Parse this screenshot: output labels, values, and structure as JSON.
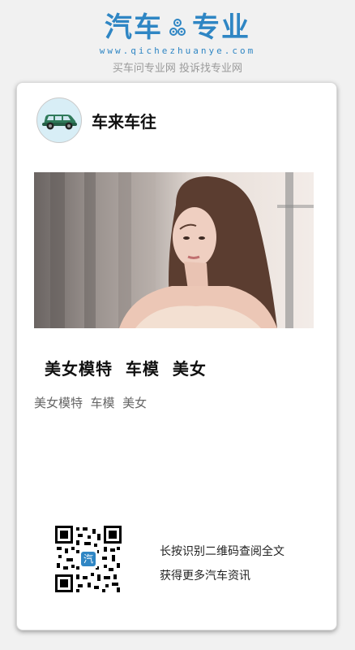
{
  "brand": {
    "logo_left": "汽车",
    "logo_right": "专业",
    "url": "www.qichezhuanye.com",
    "slogan": "买车问专业网 投诉找专业网",
    "accent_color": "#2f86c4"
  },
  "card": {
    "account_name": "车来车往",
    "avatar_icon": "car-icon",
    "title": "美女模特  车模  美女",
    "tags": "美女模特  车模  美女",
    "qr_caption_line1": "长按识别二维码查阅全文",
    "qr_caption_line2": "获得更多汽车资讯"
  }
}
